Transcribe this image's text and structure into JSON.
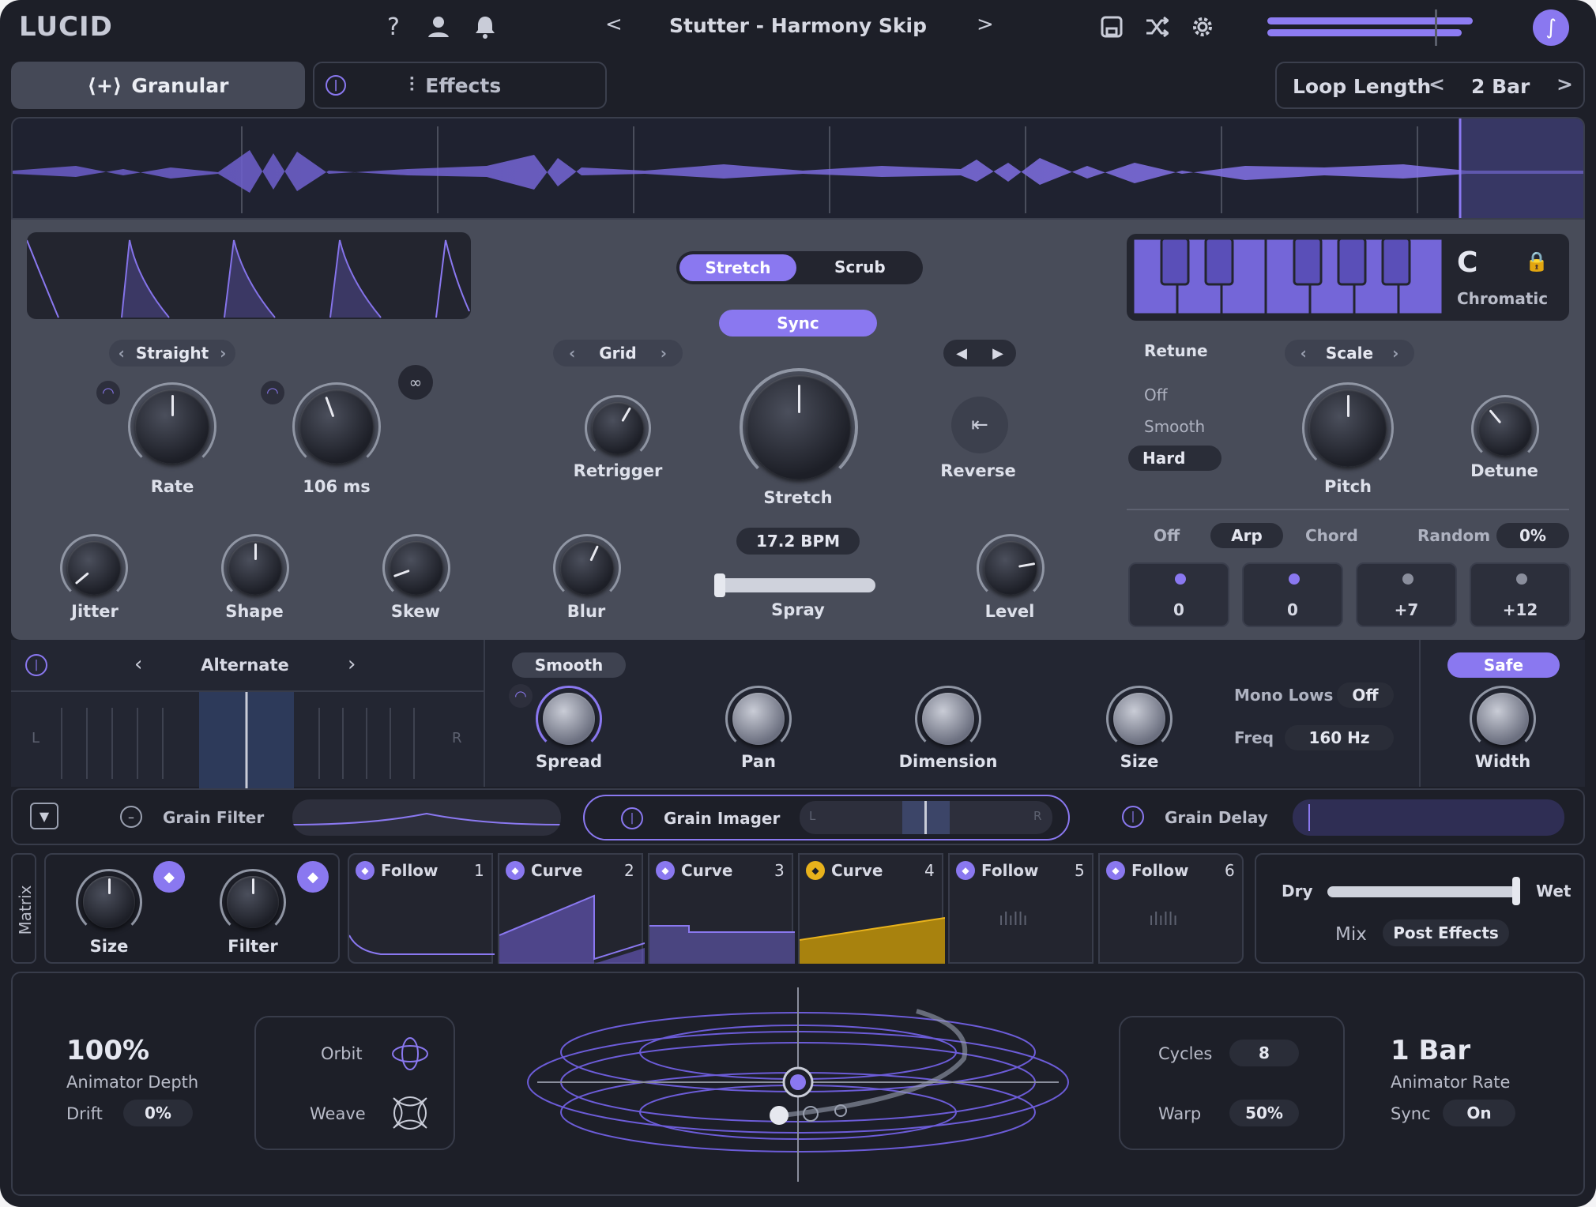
{
  "header": {
    "logo": "LUCID",
    "preset_name": "Stutter - Harmony Skip",
    "help_icon": "question-icon",
    "user_icon": "user-icon",
    "bell_icon": "bell-icon",
    "save_icon": "save-icon",
    "shuffle_icon": "shuffle-icon",
    "gear_icon": "gear-icon"
  },
  "tabs": {
    "granular": "Granular",
    "effects": "Effects"
  },
  "loop": {
    "label": "Loop Length",
    "value": "2 Bar"
  },
  "envelope": {
    "mode": "Straight",
    "rate_label": "Rate",
    "time_value": "106 ms",
    "jitter": "Jitter",
    "shape": "Shape",
    "skew": "Skew"
  },
  "stretch": {
    "mode_stretch": "Stretch",
    "mode_scrub": "Scrub",
    "sync": "Sync",
    "grid": "Grid",
    "retrigger": "Retrigger",
    "stretch_label": "Stretch",
    "reverse": "Reverse",
    "bpm": "17.2 BPM",
    "blur": "Blur",
    "spray": "Spray",
    "level": "Level"
  },
  "pitch": {
    "key": "C",
    "mode": "Chromatic",
    "retune": "Retune",
    "retune_options": [
      "Off",
      "Smooth",
      "Hard"
    ],
    "retune_selected": "Hard",
    "scale": "Scale",
    "pitch_label": "Pitch",
    "detune": "Detune",
    "arp_options": [
      "Off",
      "Arp",
      "Chord"
    ],
    "arp_selected": "Arp",
    "random_label": "Random",
    "random_value": "0%",
    "steps": [
      "0",
      "0",
      "+7",
      "+12"
    ]
  },
  "imager": {
    "pattern": "Alternate",
    "left": "L",
    "right": "R",
    "smooth": "Smooth",
    "spread": "Spread",
    "pan": "Pan",
    "dimension": "Dimension",
    "size": "Size",
    "mono_lows": "Mono Lows",
    "mono_value": "Off",
    "freq": "Freq",
    "freq_value": "160 Hz",
    "safe": "Safe",
    "width": "Width"
  },
  "modules": {
    "filter": "Grain Filter",
    "imager": "Grain Imager",
    "delay": "Grain Delay",
    "imager_l": "L",
    "imager_r": "R"
  },
  "matrix": {
    "label": "Matrix",
    "size": "Size",
    "filter": "Filter",
    "slots": [
      {
        "name": "Follow",
        "num": "1"
      },
      {
        "name": "Curve",
        "num": "2"
      },
      {
        "name": "Curve",
        "num": "3"
      },
      {
        "name": "Curve",
        "num": "4"
      },
      {
        "name": "Follow",
        "num": "5"
      },
      {
        "name": "Follow",
        "num": "6"
      }
    ]
  },
  "mix": {
    "dry": "Dry",
    "wet": "Wet",
    "mix": "Mix",
    "post": "Post Effects"
  },
  "animator": {
    "depth_value": "100%",
    "depth_label": "Animator Depth",
    "drift_label": "Drift",
    "drift_value": "0%",
    "orbit": "Orbit",
    "weave": "Weave",
    "cycles_label": "Cycles",
    "cycles_value": "8",
    "warp_label": "Warp",
    "warp_value": "50%",
    "rate_value": "1 Bar",
    "rate_label": "Animator Rate",
    "sync_label": "Sync",
    "sync_value": "On"
  },
  "colors": {
    "accent": "#8a78f0",
    "curve4": "#e8b21c",
    "bg": "#1d1f28"
  }
}
